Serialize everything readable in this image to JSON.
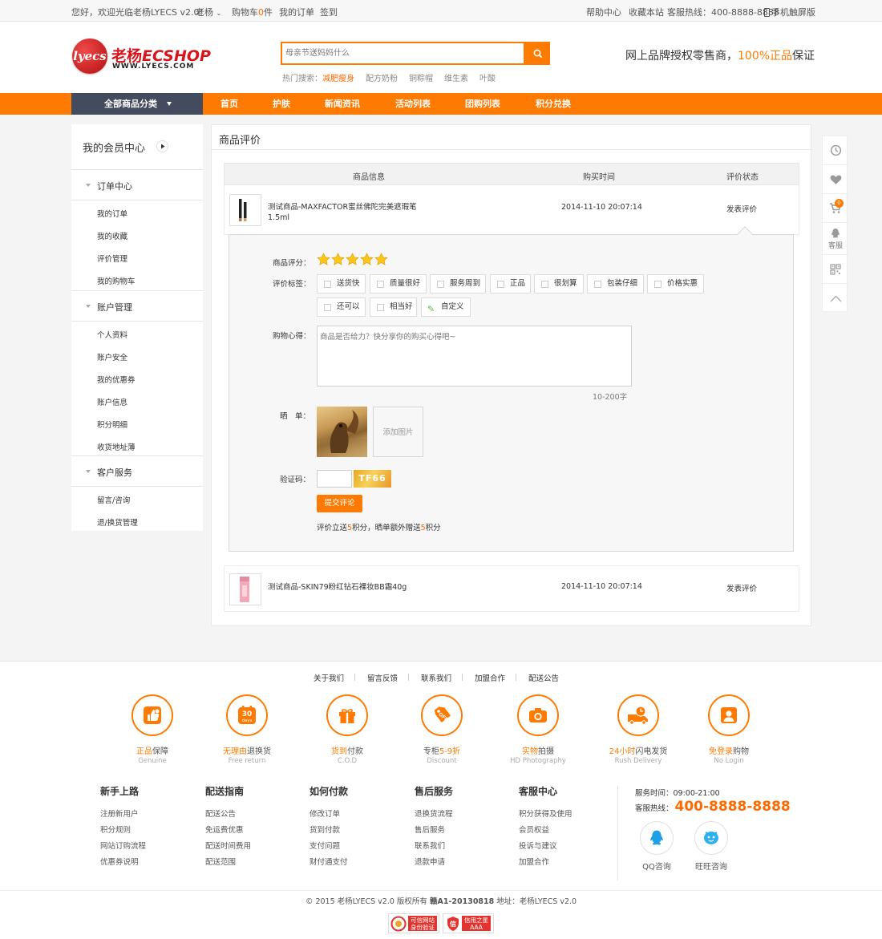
{
  "topbar": {
    "welcome": "您好，欢迎光临老杨LYECS v2.0！",
    "user": "老杨",
    "cart_prefix": "购物车",
    "cart_count": "0",
    "cart_suffix": "件",
    "orders": "我的订单",
    "signin": "签到",
    "help": "帮助中心",
    "favorite": "收藏本站",
    "hotline": "客服热线：400-8888-8888",
    "mobile": "手机触屏版"
  },
  "header": {
    "logo_badge": "lyecs",
    "logo_cn": "老杨",
    "logo_en": "ECSHOP",
    "logo_url": "WWW.LYECS.COM",
    "search_placeholder": "母亲节送妈妈什么",
    "hot_label": "热门搜索：",
    "hot_terms": [
      "减肥瘦身",
      "配方奶粉",
      "铜粽帽",
      "维生素",
      "叶酸"
    ],
    "slogan_a": "网上品牌授权零售商，",
    "slogan_b": "100%正品",
    "slogan_c": "保证"
  },
  "nav": {
    "all_categories": "全部商品分类",
    "items": [
      "首页",
      "护肤",
      "新闻资讯",
      "活动列表",
      "团购列表",
      "积分兑换"
    ]
  },
  "sidebar": {
    "title": "我的会员中心",
    "sections": [
      {
        "label": "订单中心",
        "items": [
          "我的订单",
          "我的收藏",
          "评价管理",
          "我的购物车"
        ]
      },
      {
        "label": "账户管理",
        "items": [
          "个人资料",
          "账户安全",
          "我的优惠券",
          "账户信息",
          "积分明细",
          "收货地址薄"
        ]
      },
      {
        "label": "客户服务",
        "items": [
          "留言/咨询",
          "退/换货管理"
        ]
      }
    ]
  },
  "main": {
    "title": "商品评价",
    "columns": [
      "商品信息",
      "购买时间",
      "评价状态"
    ],
    "rows": [
      {
        "name": "测试商品-MAXFACTOR蜜丝佛陀完美遮瑕笔1.5ml",
        "time": "2014-11-10 20:07:14",
        "status": "发表评价"
      },
      {
        "name": "测试商品-SKIN79粉红钻石裸妆BB霜40g",
        "time": "2014-11-10 20:07:14",
        "status": "发表评价"
      }
    ],
    "review": {
      "rating_label": "商品评分：",
      "rating": 5,
      "rating_max": 5,
      "tags_label": "评价标签：",
      "tags": [
        "送货快",
        "质量很好",
        "服务周到",
        "正品",
        "很划算",
        "包装仔细",
        "价格实惠",
        "还可以",
        "相当好",
        "自定义"
      ],
      "experience_label": "购物心得：",
      "experience_placeholder": "商品是否给力？快分享你的购买心得吧~",
      "char_limit": "10-200字",
      "photos_label": "晒　单：",
      "add_photo": "添加图片",
      "captcha_label": "验证码：",
      "captcha_code": "TF66",
      "submit": "提交评论",
      "note_a": "评价立送",
      "note_b": "5",
      "note_c": "积分，晒单额外赠送",
      "note_d": "5",
      "note_e": "积分"
    }
  },
  "right_toolbar": {
    "cart_badge": "0",
    "service_label": "客服"
  },
  "footer": {
    "links": [
      "关于我们",
      "留言反馈",
      "联系我们",
      "加盟合作",
      "配送公告"
    ],
    "services": [
      {
        "hl": "正品",
        "rest": "保障",
        "en": "Genuine",
        "icon": "thumbs-up-icon"
      },
      {
        "hl": "无理由",
        "rest": "退换货",
        "en": "Free return",
        "icon": "thirty-days-icon"
      },
      {
        "hl": "货到",
        "rest": "付款",
        "en": "C.O.D",
        "icon": "gift-icon"
      },
      {
        "hl": "专柜",
        "rest": "5-9折",
        "en": "Discount",
        "icon": "discount-tag-icon"
      },
      {
        "hl": "实物",
        "rest": "拍摄",
        "en": "HD Photography",
        "icon": "camera-icon"
      },
      {
        "hl": "24小时",
        "rest": "闪电发货",
        "en": "Rush Delivery",
        "icon": "delivery-truck-icon"
      },
      {
        "hl": "免登录",
        "rest": "购物",
        "en": "No Login",
        "icon": "user-card-icon"
      }
    ],
    "columns": [
      {
        "title": "新手上路",
        "items": [
          "注册新用户",
          "积分规则",
          "网站订购流程",
          "优惠券说明"
        ]
      },
      {
        "title": "配送指南",
        "items": [
          "配送公告",
          "免运费优惠",
          "配送时间费用",
          "配送范围"
        ]
      },
      {
        "title": "如何付款",
        "items": [
          "修改订单",
          "货到付款",
          "支付问题",
          "财付通支付"
        ]
      },
      {
        "title": "售后服务",
        "items": [
          "退换货流程",
          "售后服务",
          "联系我们",
          "退款申请"
        ]
      },
      {
        "title": "客服中心",
        "items": [
          "积分获得及使用",
          "会员权益",
          "投诉与建议",
          "加盟合作"
        ]
      }
    ],
    "service_time": "服务时间：09:00-21:00",
    "hotline_label": "客服热线：",
    "hotline_number": "400-8888-8888",
    "qq": "QQ咨询",
    "wangwang": "旺旺咨询",
    "copyright": "© 2015 老杨LYECS v2.0 版权所有",
    "icp": "赣A1-20130818",
    "address": "地址：老杨LYECS v2.0",
    "badge1_a": "可信网站",
    "badge1_b": "身份验证",
    "badge2_a": "信用之星",
    "badge2_b": "AAA"
  },
  "colors": {
    "accent": "#ff7a00",
    "nav_dark": "#434c5e",
    "brand_red": "#d6141c",
    "star": "#ffc61a"
  }
}
